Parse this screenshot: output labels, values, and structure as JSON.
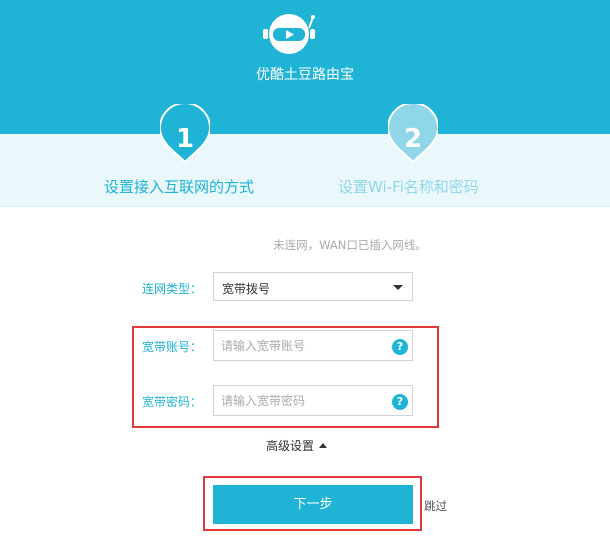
{
  "header": {
    "app_title": "优酷土豆路由宝",
    "logo": "robot-logo-icon"
  },
  "steps": [
    {
      "number": "1",
      "label": "设置接入互联网的方式",
      "active": true
    },
    {
      "number": "2",
      "label": "设置Wi-Fi名称和密码",
      "active": false
    }
  ],
  "form": {
    "status_text": "未连网，WAN口已插入网线。",
    "connection_type": {
      "label": "连网类型：",
      "value": "宽带拨号"
    },
    "account": {
      "label": "宽带账号：",
      "placeholder": "请输入宽带账号",
      "help": "?"
    },
    "password": {
      "label": "宽带密码：",
      "placeholder": "请输入宽带密码",
      "help": "?"
    },
    "advanced_label": "高级设置"
  },
  "actions": {
    "next_label": "下一步",
    "skip_label": "跳过"
  },
  "colors": {
    "brand": "#1fb3d6",
    "highlight": "#e23a3a",
    "inactive_step": "#8fd6e8"
  }
}
